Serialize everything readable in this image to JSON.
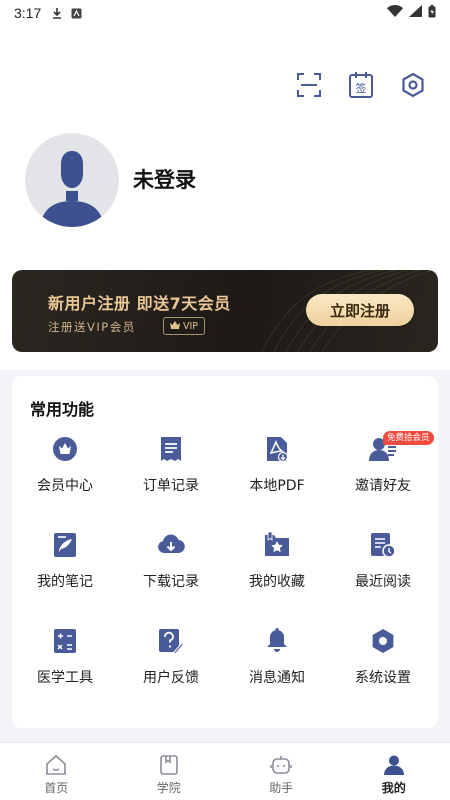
{
  "status_bar": {
    "time": "3:17"
  },
  "header": {
    "icons": [
      "scan-icon",
      "sign-in-icon",
      "settings-icon"
    ],
    "sign_label": "签"
  },
  "profile": {
    "name": "未登录"
  },
  "vip_banner": {
    "title": "新用户注册  即送7天会员",
    "subtitle": "注册送VIP会员",
    "badge": "VIP",
    "button": "立即注册"
  },
  "functions": {
    "title": "常用功能",
    "items": [
      {
        "label": "会员中心",
        "icon": "crown-icon"
      },
      {
        "label": "订单记录",
        "icon": "order-icon"
      },
      {
        "label": "本地PDF",
        "icon": "pdf-icon"
      },
      {
        "label": "邀请好友",
        "icon": "invite-icon"
      },
      {
        "label": "我的笔记",
        "icon": "note-icon"
      },
      {
        "label": "下载记录",
        "icon": "download-icon"
      },
      {
        "label": "我的收藏",
        "icon": "favorite-icon"
      },
      {
        "label": "最近阅读",
        "icon": "recent-reading-icon"
      },
      {
        "label": "医学工具",
        "icon": "calculator-icon"
      },
      {
        "label": "用户反馈",
        "icon": "feedback-icon"
      },
      {
        "label": "消息通知",
        "icon": "bell-icon"
      },
      {
        "label": "系统设置",
        "icon": "settings-icon"
      }
    ],
    "invite_badge": "免费拾会员"
  },
  "bottom_nav": {
    "items": [
      {
        "label": "首页",
        "icon": "home-icon"
      },
      {
        "label": "学院",
        "icon": "academy-icon"
      },
      {
        "label": "助手",
        "icon": "assistant-icon"
      },
      {
        "label": "我的",
        "icon": "profile-icon"
      }
    ],
    "active": "我的"
  },
  "colors": {
    "accent": "#4a5b99",
    "badge_red": "#ef4b3f",
    "vip_gold": "#e9c796"
  }
}
